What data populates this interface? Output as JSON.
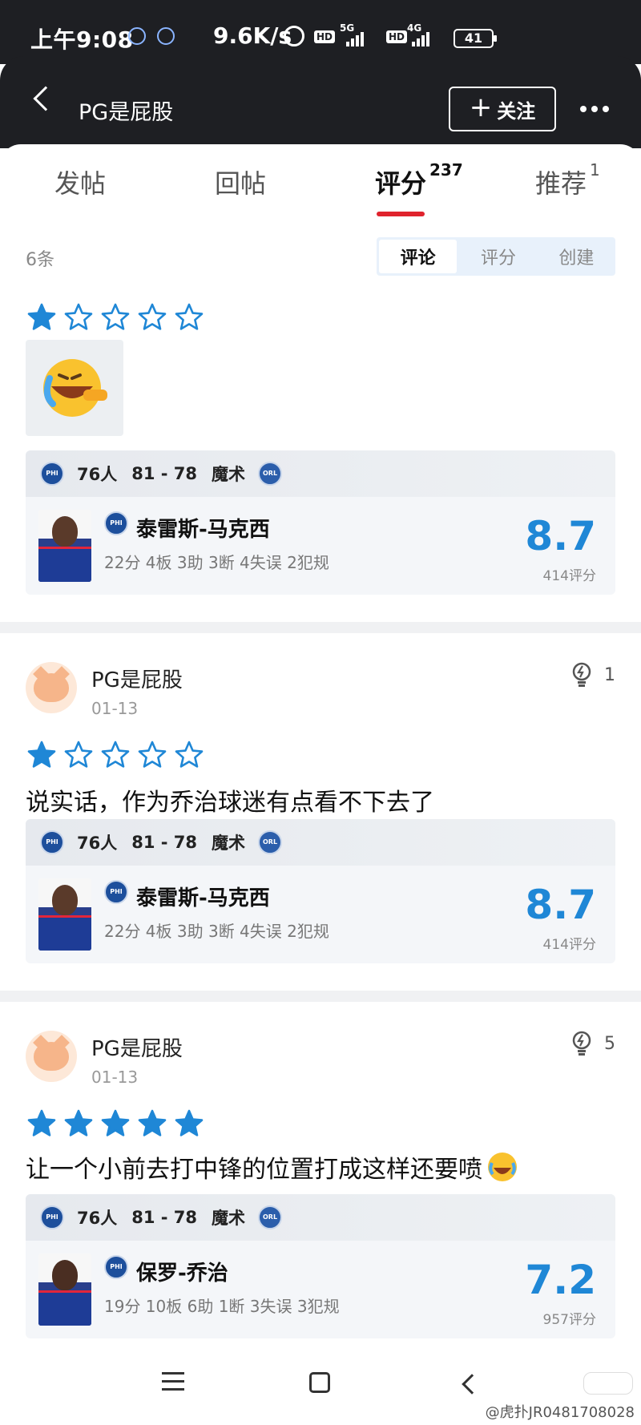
{
  "status_bar": {
    "time": "上午9:08",
    "net_speed": "9.6K/s",
    "hd1": "HD",
    "net1": "5G",
    "hd2": "HD",
    "net2": "4G",
    "battery": "41"
  },
  "header": {
    "title": "PG是屁股",
    "follow_label": "关注"
  },
  "tabs": [
    {
      "label": "发帖",
      "count": ""
    },
    {
      "label": "回帖",
      "count": ""
    },
    {
      "label": "评分",
      "count": "237"
    },
    {
      "label": "推荐",
      "count": "1"
    }
  ],
  "list": {
    "count_label": "6条",
    "filters": [
      "评论",
      "评分",
      "创建"
    ],
    "active_filter": "评论"
  },
  "game": {
    "team_home": "76人",
    "score": "81 - 78",
    "team_away": "魔术"
  },
  "posts": [
    {
      "user": "",
      "date": "",
      "likes": "",
      "stars": 1,
      "text": "",
      "player": {
        "name": "泰雷斯-马克西",
        "stats": "22分 4板 3助 3断 4失误 2犯规",
        "rating": "8.7",
        "rating_count": "414评分"
      }
    },
    {
      "user": "PG是屁股",
      "date": "01-13",
      "likes": "1",
      "stars": 1,
      "text": "说实话，作为乔治球迷有点看不下去了",
      "player": {
        "name": "泰雷斯-马克西",
        "stats": "22分 4板 3助 3断 4失误 2犯规",
        "rating": "8.7",
        "rating_count": "414评分"
      }
    },
    {
      "user": "PG是屁股",
      "date": "01-13",
      "likes": "5",
      "stars": 5,
      "text": "让一个小前去打中锋的位置打成这样还要喷",
      "player": {
        "name": "保罗-乔治",
        "stats": "19分 10板 6助 1断 3失误 3犯规",
        "rating": "7.2",
        "rating_count": "957评分"
      }
    }
  ],
  "watermark": "@虎扑JR0481708028",
  "colors": {
    "accent_red": "#e0232d",
    "star_blue": "#1f87d6",
    "header_bg": "#1e1f23"
  }
}
